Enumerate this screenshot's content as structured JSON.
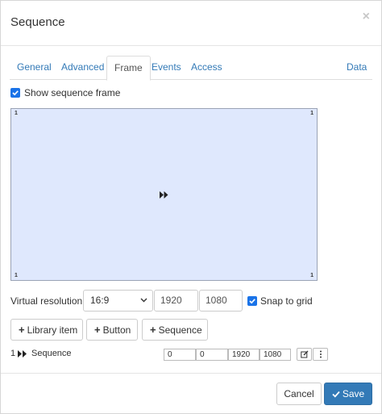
{
  "dialog": {
    "title": "Sequence",
    "close_glyph": "×"
  },
  "tabs": [
    {
      "label": "General"
    },
    {
      "label": "Advanced"
    },
    {
      "label": "Frame",
      "active": true
    },
    {
      "label": "Events"
    },
    {
      "label": "Access"
    },
    {
      "label": "Data"
    }
  ],
  "show_frame": {
    "label": "Show sequence frame",
    "checked": true
  },
  "frame": {
    "corner_tl": "1",
    "corner_tr": "1",
    "corner_bl": "1",
    "corner_br": "1",
    "icon": "fast-forward-icon",
    "background": "#dfe8fd"
  },
  "resolution": {
    "label": "Virtual resolution",
    "aspect": "16:9",
    "width": "1920",
    "height": "1080",
    "snap_label": "Snap to grid",
    "snap_checked": true
  },
  "add_buttons": {
    "library_item": "Library item",
    "button": "Button",
    "sequence": "Sequence"
  },
  "sequence_row": {
    "index": "1",
    "name": "Sequence",
    "x": "0",
    "y": "0",
    "w": "1920",
    "h": "1080",
    "edit_icon": "edit-icon",
    "more_icon": "more-vertical-icon"
  },
  "footer": {
    "cancel": "Cancel",
    "save": "Save"
  },
  "colors": {
    "accent": "#337ab7",
    "checkbox": "#1a73e8"
  }
}
